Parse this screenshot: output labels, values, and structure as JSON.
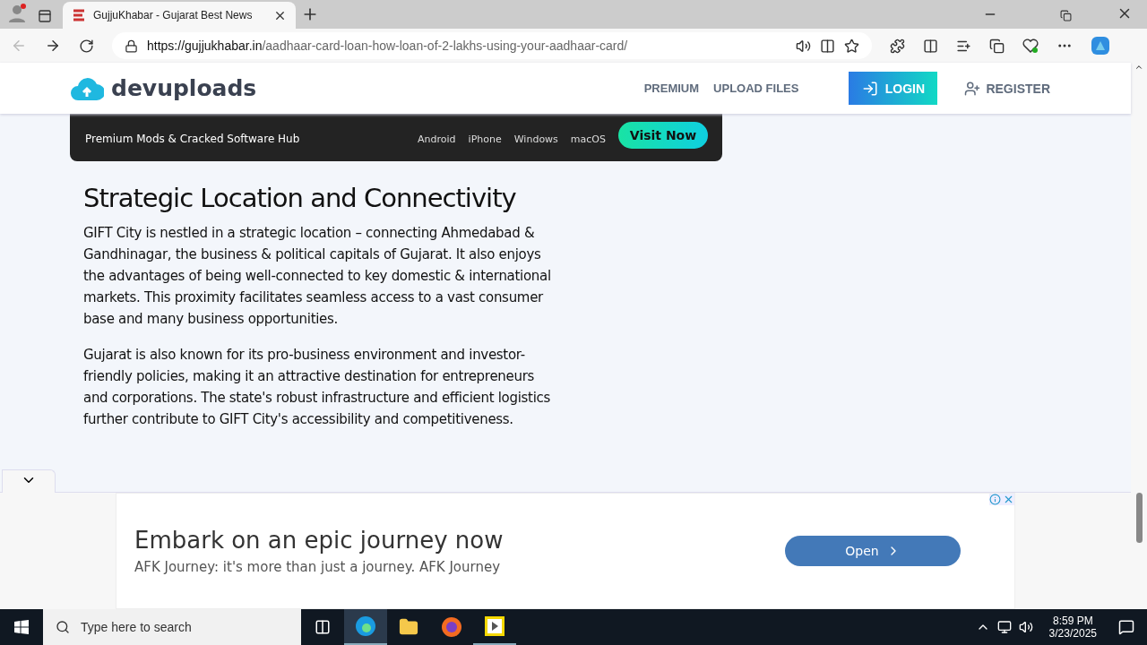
{
  "browser": {
    "tabs": [
      {
        "title": "GujjuKhabar - Gujarat Best News",
        "selected": true
      }
    ],
    "url_host": "https://gujjukhabar.in",
    "url_path": "/aadhaar-card-loan-how-loan-of-2-lakhs-using-your-aadhaar-card/"
  },
  "site_header": {
    "logo": "devuploads",
    "nav": [
      "PREMIUM",
      "UPLOAD FILES"
    ],
    "login": "LOGIN",
    "register": "REGISTER"
  },
  "promo": {
    "tagline": "Premium Mods & Cracked Software Hub",
    "platforms": [
      "Android",
      "iPhone",
      "Windows",
      "macOS"
    ],
    "cta": "Visit Now"
  },
  "article": {
    "heading": "Strategic Location and Connectivity",
    "paragraphs": [
      "GIFT City is nestled in a strategic location – connecting Ahmedabad & Gandhinagar, the business & political capitals of Gujarat. It also enjoys the advantages of being well-connected to key domestic & international markets. This proximity facilitates seamless access to a vast consumer base and many business opportunities.",
      "Gujarat is also known for its pro-business environment and investor-friendly policies, making it an attractive destination for entrepreneurs and corporations. The state's robust infrastructure and efficient logistics further contribute to GIFT City's accessibility and competitiveness."
    ]
  },
  "ad": {
    "headline": "Embark on an epic journey now",
    "body": "AFK Journey: it's more than just a journey. AFK Journey",
    "button": "Open"
  },
  "taskbar": {
    "search_placeholder": "Type here to search",
    "time": "8:59 PM",
    "date": "3/23/2025"
  }
}
